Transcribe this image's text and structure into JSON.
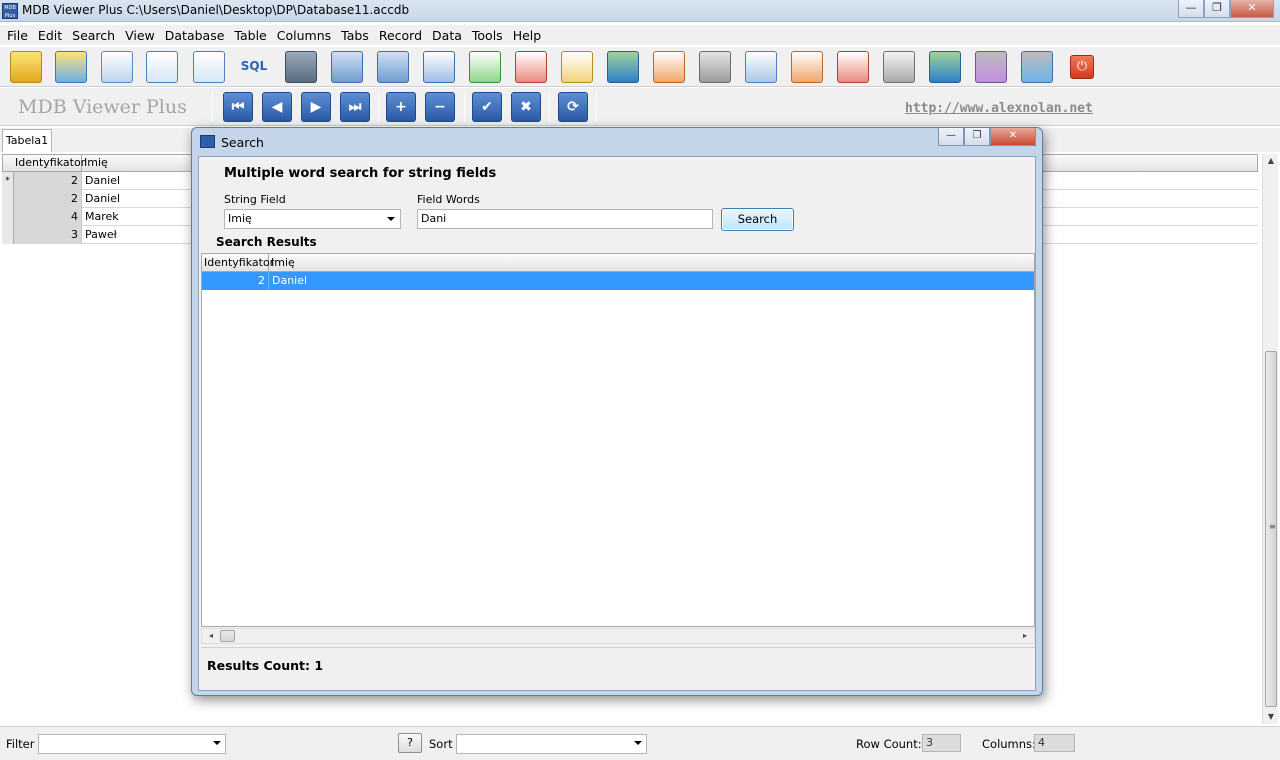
{
  "window": {
    "title": "MDB Viewer Plus C:\\Users\\Daniel\\Desktop\\DP\\Database11.accdb",
    "app_icon_text": "MDB Plus",
    "min": "—",
    "max": "❐",
    "close": "✕"
  },
  "menu": [
    "File",
    "Edit",
    "Search",
    "View",
    "Database",
    "Table",
    "Columns",
    "Tabs",
    "Record",
    "Data",
    "Tools",
    "Help"
  ],
  "toolbar": {
    "sql_label": "SQL",
    "icons": [
      "open-folder-icon",
      "open-recent-icon",
      "table-properties-icon",
      "search-icon",
      "advanced-search-icon",
      "sql-icon",
      "add-table-icon",
      "tables-icon",
      "column-structure-icon",
      "table-info-icon",
      "add-row-icon",
      "delete-row-icon",
      "edit-table-icon",
      "rename-icon",
      "export-table-icon",
      "settings-icon",
      "resize-columns-icon",
      "import-icon",
      "remove-icon",
      "print-icon",
      "database-icon",
      "import-data-icon",
      "export-data-icon",
      "exit-icon"
    ]
  },
  "brand": "MDB Viewer Plus",
  "site_link": "http://www.alexnolan.net",
  "nav": {
    "first": "⏮",
    "prev": "◀",
    "next": "▶",
    "last": "⏭",
    "add": "+",
    "remove": "−",
    "post": "✔",
    "cancel": "✖",
    "refresh": "⟳"
  },
  "tabs": [
    "Tabela1"
  ],
  "grid": {
    "columns": [
      "Identyfikator",
      "Imię"
    ],
    "rows": [
      {
        "indicator": "*",
        "id": "2",
        "name": "Daniel"
      },
      {
        "indicator": "",
        "id": "2",
        "name": "Daniel"
      },
      {
        "indicator": "",
        "id": "4",
        "name": "Marek"
      },
      {
        "indicator": "",
        "id": "3",
        "name": "Paweł"
      }
    ]
  },
  "statusbar": {
    "filter_label": "Filter",
    "help_button": "?",
    "sort_label": "Sort",
    "row_count_label": "Row Count:",
    "row_count": "3",
    "columns_label": "Columns:",
    "columns": "4"
  },
  "dialog": {
    "title": "Search",
    "heading": "Multiple word search for string fields",
    "string_field_label": "String Field",
    "string_field_value": "Imię",
    "field_words_label": "Field Words",
    "field_words_value": "Dani",
    "search_button": "Search",
    "results_label": "Search Results",
    "results_columns": [
      "Identyfikator",
      "Imię"
    ],
    "results_rows": [
      {
        "id": "2",
        "name": "Daniel"
      }
    ],
    "results_count_label": "Results Count: 1"
  },
  "colors": {
    "accent": "#3399ff",
    "titlebar": "#c7d6e8",
    "close": "#c85a44"
  }
}
